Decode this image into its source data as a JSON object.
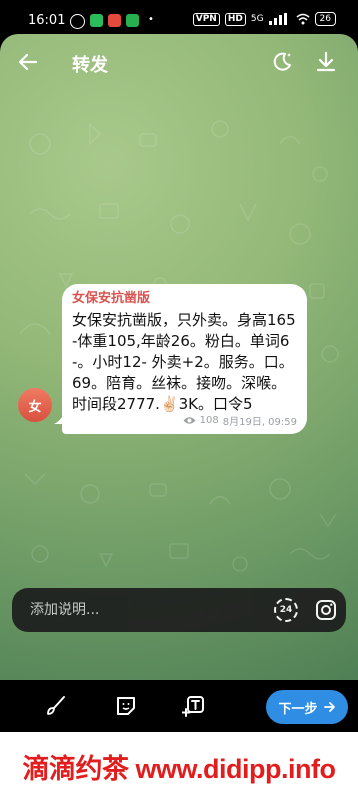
{
  "status_bar": {
    "time": "16:01",
    "vpn": "VPN",
    "hd": "HD",
    "signal": "5G",
    "battery": "26"
  },
  "header": {
    "title": "转发"
  },
  "message": {
    "avatar_initial": "女",
    "sender": "女保安抗凿版",
    "text": "女保安抗凿版，只外卖。身高165-体重105,年龄26。粉白。单词6-。小时12- 外卖+2。服务。口。69。陪育。丝袜。接吻。深喉。时间段2777.✌🏻3K。口令5",
    "views": "108",
    "date": "8月19日, 09:59"
  },
  "caption": {
    "placeholder": "添加说明...",
    "timer_label": "24"
  },
  "toolbar": {
    "next_label": "下一步"
  },
  "banner": {
    "text": "滴滴约茶 www.didipp.info"
  }
}
